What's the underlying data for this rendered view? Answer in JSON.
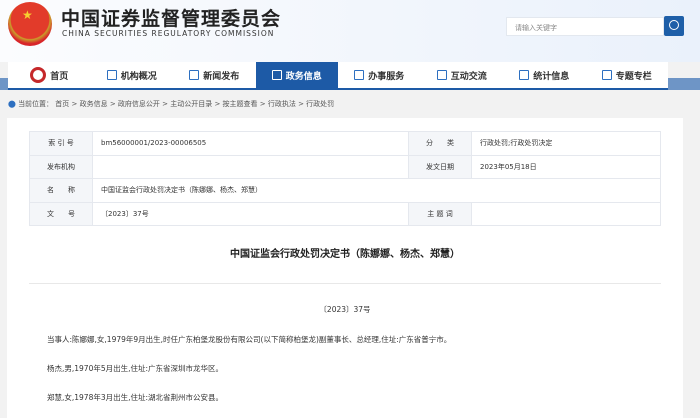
{
  "header": {
    "title_cn": "中国证券监督管理委员会",
    "title_en": "CHINA SECURITIES REGULATORY COMMISSION",
    "search_placeholder": "请输入关键字"
  },
  "nav": [
    {
      "label": "首页",
      "icon": "emblem-icon"
    },
    {
      "label": "机构概况",
      "icon": "building-icon"
    },
    {
      "label": "新闻发布",
      "icon": "news-icon"
    },
    {
      "label": "政务信息",
      "icon": "screen-icon",
      "active": true
    },
    {
      "label": "办事服务",
      "icon": "form-icon"
    },
    {
      "label": "互动交流",
      "icon": "chat-icon"
    },
    {
      "label": "统计信息",
      "icon": "chart-icon"
    },
    {
      "label": "专题专栏",
      "icon": "doc-icon"
    }
  ],
  "breadcrumb": "当前位置： 首页 > 政务信息 > 政府信息公开 > 主动公开目录 > 按主题查看 > 行政执法 > 行政处罚",
  "meta": {
    "index_label": "索 引 号",
    "index": "bm56000001/2023-00006505",
    "category_label": "分　　类",
    "category": "行政处罚;行政处罚决定",
    "publisher_label": "发布机构",
    "publisher": "",
    "date_label": "发文日期",
    "date": "2023年05月18日",
    "name_label": "名　　称",
    "name": "中国证监会行政处罚决定书（陈娜娜、杨杰、郑慧）",
    "docno_label": "文　　号",
    "docno": "〔2023〕37号",
    "keywords_label": "主 题 词",
    "keywords": ""
  },
  "article": {
    "title": "中国证监会行政处罚决定书（陈娜娜、杨杰、郑慧）",
    "docno": "〔2023〕37号",
    "paragraphs": [
      "当事人:陈娜娜,女,1979年9月出生,时任广东柏堡龙股份有限公司(以下简称柏堡龙)副董事长、总经理,住址:广东省普宁市。",
      "杨杰,男,1970年5月出生,住址:广东省深圳市龙华区。",
      "郑慧,女,1978年3月出生,住址:湖北省荆州市公安县。"
    ]
  },
  "colors": {
    "brand": "#1d5aa6"
  }
}
